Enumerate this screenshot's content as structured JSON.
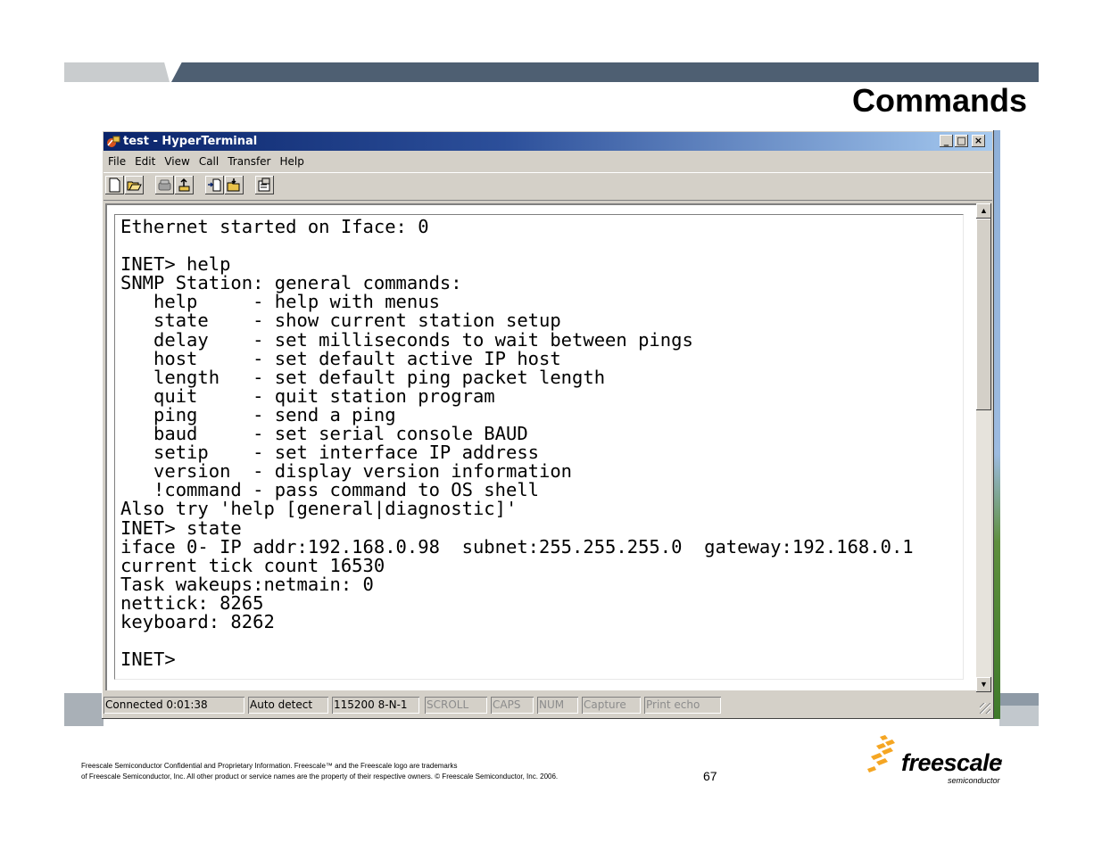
{
  "slide": {
    "title": "Commands",
    "footer_line1": "Freescale Semiconductor Confidential and Proprietary Information. Freescale™ and the Freescale logo are trademarks",
    "footer_line2": "of Freescale Semiconductor, Inc. All other product or service names are the property of their respective owners. © Freescale Semiconductor, Inc. 2006.",
    "page_number": "67",
    "logo": {
      "word": "freescale",
      "tm": "™",
      "sub": "semiconductor"
    }
  },
  "window": {
    "title": "test - HyperTerminal",
    "caption_buttons": {
      "minimize": "_",
      "maximize": "□",
      "close": "×"
    },
    "menu": [
      "File",
      "Edit",
      "View",
      "Call",
      "Transfer",
      "Help"
    ],
    "toolbar_icons": [
      "new-file-icon",
      "open-folder-icon",
      "call-phone-icon",
      "disconnect-icon",
      "send-file-icon",
      "receive-file-icon",
      "properties-icon"
    ]
  },
  "terminal": {
    "lines": [
      "Ethernet started on Iface: 0",
      "",
      "INET> help",
      "SNMP Station: general commands:",
      "   help     - help with menus",
      "   state    - show current station setup",
      "   delay    - set milliseconds to wait between pings",
      "   host     - set default active IP host",
      "   length   - set default ping packet length",
      "   quit     - quit station program",
      "   ping     - send a ping",
      "   baud     - set serial console BAUD",
      "   setip    - set interface IP address",
      "   version  - display version information",
      "   !command - pass command to OS shell",
      "Also try 'help [general|diagnostic]'",
      "INET> state",
      "iface 0- IP addr:192.168.0.98  subnet:255.255.255.0  gateway:192.168.0.1",
      "current tick count 16530",
      "Task wakeups:netmain: 0",
      "nettick: 8265",
      "keyboard: 8262",
      "",
      "INET>"
    ]
  },
  "status": {
    "connected": "Connected 0:01:38",
    "detect": "Auto detect",
    "settings": "115200 8-N-1",
    "scroll": "SCROLL",
    "caps": "CAPS",
    "num": "NUM",
    "capture": "Capture",
    "print_echo": "Print echo"
  }
}
